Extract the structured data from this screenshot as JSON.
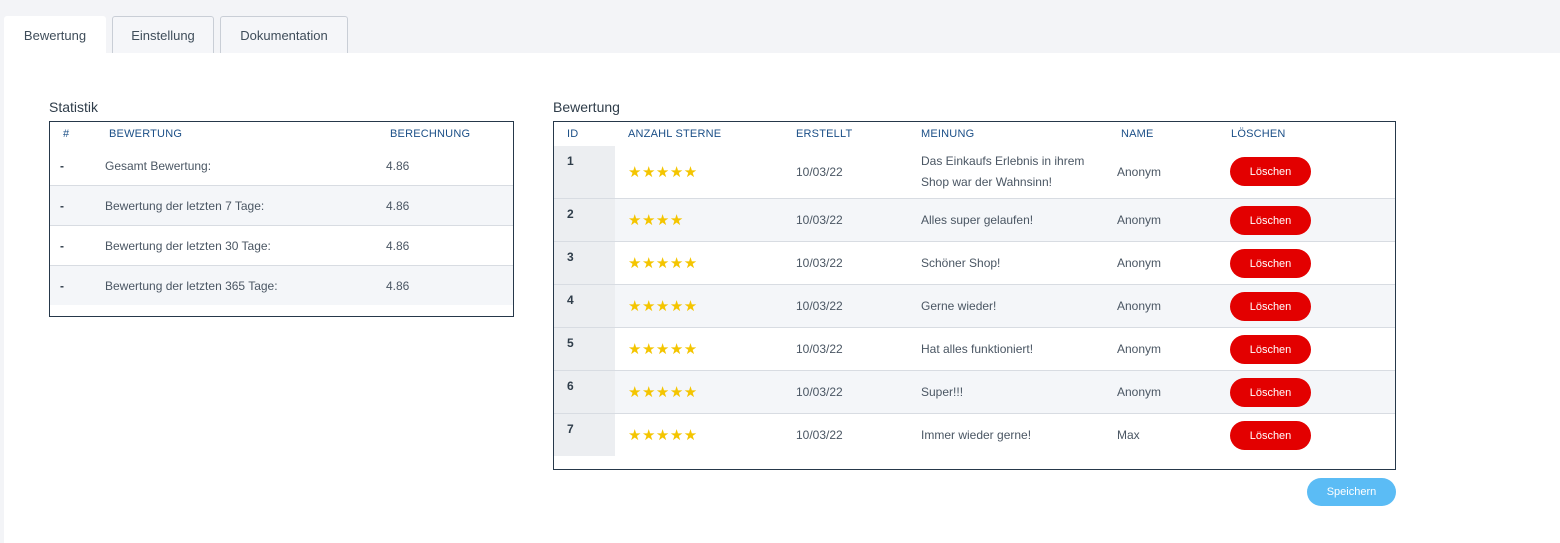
{
  "tabs": [
    {
      "label": "Bewertung",
      "active": true
    },
    {
      "label": "Einstellung",
      "active": false
    },
    {
      "label": "Dokumentation",
      "active": false
    }
  ],
  "statistik": {
    "title": "Statistik",
    "headers": {
      "hash": "#",
      "bewertung": "BEWERTUNG",
      "berechnung": "BERECHNUNG"
    },
    "rows": [
      {
        "marker": "-",
        "label": "Gesamt Bewertung:",
        "value": "4.86"
      },
      {
        "marker": "-",
        "label": "Bewertung der letzten 7 Tage:",
        "value": "4.86"
      },
      {
        "marker": "-",
        "label": "Bewertung der letzten 30 Tage:",
        "value": "4.86"
      },
      {
        "marker": "-",
        "label": "Bewertung der letzten 365 Tage:",
        "value": "4.86"
      }
    ]
  },
  "bewertung": {
    "title": "Bewertung",
    "headers": {
      "id": "ID",
      "sterne": "ANZAHL STERNE",
      "erstellt": "ERSTELLT",
      "meinung": "MEINUNG",
      "name": "NAME",
      "loeschen": "LÖSCHEN"
    },
    "rows": [
      {
        "id": "1",
        "stars": "★★★★★",
        "rating": 5,
        "erstellt": "10/03/22",
        "meinung_line1": "Das Einkaufs Erlebnis in ihrem",
        "meinung_line2": "Shop war der Wahnsinn!",
        "name": "Anonym",
        "delete_label": "Löschen"
      },
      {
        "id": "2",
        "stars": "★★★★",
        "rating": 4,
        "erstellt": "10/03/22",
        "meinung_line1": "Alles super gelaufen!",
        "meinung_line2": "",
        "name": "Anonym",
        "delete_label": "Löschen"
      },
      {
        "id": "3",
        "stars": "★★★★★",
        "rating": 5,
        "erstellt": "10/03/22",
        "meinung_line1": "Schöner Shop!",
        "meinung_line2": "",
        "name": "Anonym",
        "delete_label": "Löschen"
      },
      {
        "id": "4",
        "stars": "★★★★★",
        "rating": 5,
        "erstellt": "10/03/22",
        "meinung_line1": "Gerne wieder!",
        "meinung_line2": "",
        "name": "Anonym",
        "delete_label": "Löschen"
      },
      {
        "id": "5",
        "stars": "★★★★★",
        "rating": 5,
        "erstellt": "10/03/22",
        "meinung_line1": "Hat alles funktioniert!",
        "meinung_line2": "",
        "name": "Anonym",
        "delete_label": "Löschen"
      },
      {
        "id": "6",
        "stars": "★★★★★",
        "rating": 5,
        "erstellt": "10/03/22",
        "meinung_line1": "Super!!!",
        "meinung_line2": "",
        "name": "Anonym",
        "delete_label": "Löschen"
      },
      {
        "id": "7",
        "stars": "★★★★★",
        "rating": 5,
        "erstellt": "10/03/22",
        "meinung_line1": "Immer wieder gerne!",
        "meinung_line2": "",
        "name": "Max",
        "delete_label": "Löschen"
      }
    ],
    "save_label": "Speichern"
  },
  "colors": {
    "delete_button": "#e30000",
    "save_button": "#5bbcf5",
    "star": "#f4c500",
    "header_text": "#1b4f87"
  }
}
